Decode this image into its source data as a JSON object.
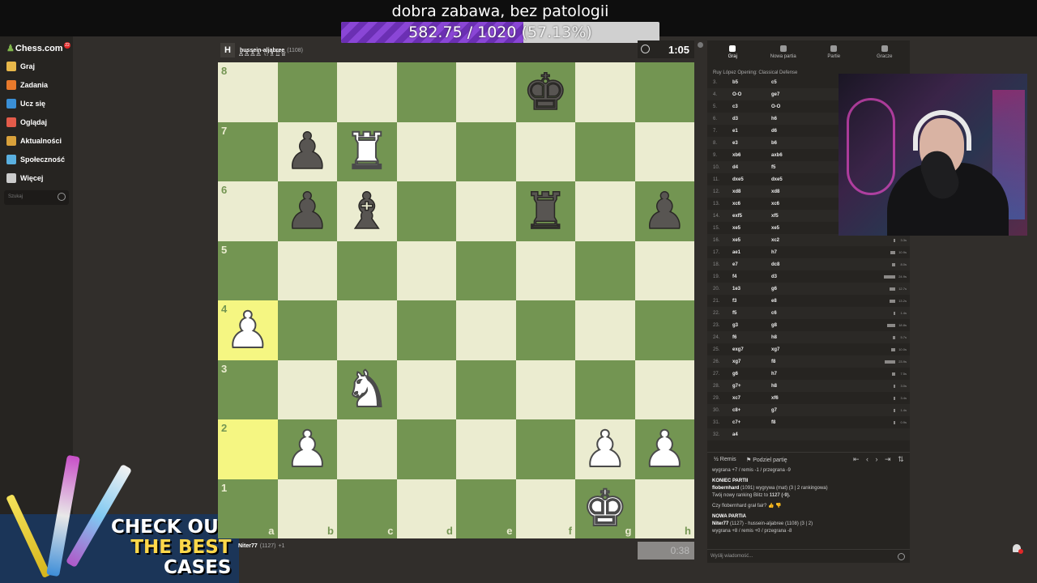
{
  "overlay": {
    "title": "dobra zabawa, bez patologii",
    "progress_text": "582.75 / 1020",
    "progress_pct_text": "(57.13%)",
    "progress_fraction": 0.5713,
    "fill_color": "#7b3cc6"
  },
  "sidebar": {
    "logo": "Chess.com",
    "badge": "22",
    "items": [
      {
        "label": "Graj",
        "icon": "play-icon",
        "color": "#e8b84a"
      },
      {
        "label": "Zadania",
        "icon": "puzzle-icon",
        "color": "#e8792b"
      },
      {
        "label": "Ucz się",
        "icon": "learn-icon",
        "color": "#3a8fd6"
      },
      {
        "label": "Oglądaj",
        "icon": "watch-icon",
        "color": "#e35b4a"
      },
      {
        "label": "Aktualności",
        "icon": "news-icon",
        "color": "#d9a13b"
      },
      {
        "label": "Społeczność",
        "icon": "community-icon",
        "color": "#5ab0e0"
      },
      {
        "label": "Więcej",
        "icon": "more-icon",
        "color": "#cccccc"
      }
    ],
    "search_placeholder": "Szukaj"
  },
  "promo": {
    "line1": "CHECK OUT",
    "line2": "THE BEST",
    "line3": "CASES"
  },
  "top_player": {
    "name": "hussein-aljabree",
    "rating": "(1108)",
    "captured": "♙♙♙♙ ♘♗♖♕",
    "clock": "1:05"
  },
  "bottom_player": {
    "name": "Niter77",
    "rating": "(1127)",
    "captured": "+1",
    "clock": "0:38"
  },
  "board": {
    "files": [
      "a",
      "b",
      "c",
      "d",
      "e",
      "f",
      "g",
      "h"
    ],
    "ranks": [
      "8",
      "7",
      "6",
      "5",
      "4",
      "3",
      "2",
      "1"
    ],
    "highlight": [
      "a4",
      "a2"
    ],
    "pieces": {
      "f8": {
        "glyph": "♚",
        "color": "black",
        "name": "black-king"
      },
      "b7": {
        "glyph": "♟",
        "color": "black",
        "name": "black-pawn"
      },
      "c7": {
        "glyph": "♜",
        "color": "white",
        "name": "white-rook"
      },
      "b6": {
        "glyph": "♟",
        "color": "black",
        "name": "black-pawn"
      },
      "c6": {
        "glyph": "♝",
        "color": "black",
        "name": "black-bishop"
      },
      "f6": {
        "glyph": "♜",
        "color": "black",
        "name": "black-rook"
      },
      "h6": {
        "glyph": "♟",
        "color": "black",
        "name": "black-pawn"
      },
      "a4": {
        "glyph": "♟",
        "color": "white",
        "name": "white-pawn"
      },
      "c3": {
        "glyph": "♞",
        "color": "white",
        "name": "white-knight"
      },
      "b2": {
        "glyph": "♟",
        "color": "white",
        "name": "white-pawn"
      },
      "g2": {
        "glyph": "♟",
        "color": "white",
        "name": "white-pawn"
      },
      "h2": {
        "glyph": "♟",
        "color": "white",
        "name": "white-pawn"
      },
      "g1": {
        "glyph": "♚",
        "color": "white",
        "name": "white-king"
      }
    }
  },
  "panel": {
    "tabs": [
      {
        "label": "Graj",
        "icon": "play-tab-icon",
        "active": true
      },
      {
        "label": "Nowa partia",
        "icon": "new-game-icon",
        "active": false
      },
      {
        "label": "Partie",
        "icon": "games-icon",
        "active": false
      },
      {
        "label": "Gracze",
        "icon": "players-icon",
        "active": false
      }
    ],
    "opening": "Ruy López Opening: Classical Defense",
    "moves": [
      {
        "n": "3.",
        "w": "b5",
        "b": "c5"
      },
      {
        "n": "4.",
        "w": "O-O",
        "b": "ge7"
      },
      {
        "n": "5.",
        "w": "c3",
        "b": "O-O"
      },
      {
        "n": "6.",
        "w": "d3",
        "b": "h6"
      },
      {
        "n": "7.",
        "w": "e1",
        "b": "d6"
      },
      {
        "n": "8.",
        "w": "e3",
        "b": "b6"
      },
      {
        "n": "9.",
        "w": "xb6",
        "b": "axb6"
      },
      {
        "n": "10.",
        "w": "d4",
        "b": "f5"
      },
      {
        "n": "11.",
        "w": "dxe5",
        "b": "dxe5"
      },
      {
        "n": "12.",
        "w": "xd8",
        "b": "xd8"
      },
      {
        "n": "13.",
        "w": "xc6",
        "b": "xc6"
      },
      {
        "n": "14.",
        "w": "exf5",
        "b": "xf5"
      },
      {
        "n": "15.",
        "w": "xe5",
        "b": "xe5",
        "t": "8.0s"
      },
      {
        "n": "16.",
        "w": "xe5",
        "b": "xc2",
        "t": "3.3s"
      },
      {
        "n": "17.",
        "w": "ae1",
        "b": "h7",
        "t": "10.9s"
      },
      {
        "n": "18.",
        "w": "e7",
        "b": "dc8",
        "t": "8.0s"
      },
      {
        "n": "19.",
        "w": "f4",
        "b": "d3",
        "t": "24.9s"
      },
      {
        "n": "20.",
        "w": "1e3",
        "b": "g6",
        "t": "12.7s"
      },
      {
        "n": "21.",
        "w": "f3",
        "b": "e8",
        "t": "13.2s"
      },
      {
        "n": "22.",
        "w": "f5",
        "b": "c6",
        "t": "1.4s"
      },
      {
        "n": "23.",
        "w": "g3",
        "b": "g8",
        "t": "18.8s"
      },
      {
        "n": "24.",
        "w": "f6",
        "b": "h8",
        "t": "5.7s"
      },
      {
        "n": "25.",
        "w": "exg7",
        "b": "xg7",
        "t": "10.0s"
      },
      {
        "n": "26.",
        "w": "xg7",
        "b": "f8",
        "t": "23.9s"
      },
      {
        "n": "27.",
        "w": "g6",
        "b": "h7",
        "t": "7.5s"
      },
      {
        "n": "28.",
        "w": "g7+",
        "b": "h8",
        "t": "3.0s"
      },
      {
        "n": "29.",
        "w": "xc7",
        "b": "xf6",
        "t": "3.4s"
      },
      {
        "n": "30.",
        "w": "c8+",
        "b": "g7",
        "t": "1.4s"
      },
      {
        "n": "31.",
        "w": "c7+",
        "b": "f8",
        "t": "0.9s"
      },
      {
        "n": "32.",
        "w": "a4",
        "b": ""
      }
    ],
    "draw_label": "Remis",
    "share_label": "Podziel partię",
    "nav_arrows": "⇤ ‹ › ⇥ ⇅",
    "chat": {
      "score_line1": "wygrana +7 / remis -1 / przegrana -9",
      "end_header": "KONIEC PARTII",
      "end_user": "flobernhard",
      "end_text": "(1091) wygrywa (mat) (3 | 2 rankingowa)",
      "rating_text": "Twój nowy ranking Blitz to",
      "rating_value": "1127 (-9).",
      "fair_q": "Czy flobernhard grał fair?",
      "new_header": "NOWA PARTIA",
      "new_user": "Niter77",
      "new_text": "(1127) - hussein-aljabree (1108) (3 | 2)",
      "score_line2": "wygrana +8 / remis +0 / przegrana -8"
    },
    "chat_placeholder": "Wyślij wiadomość..."
  }
}
